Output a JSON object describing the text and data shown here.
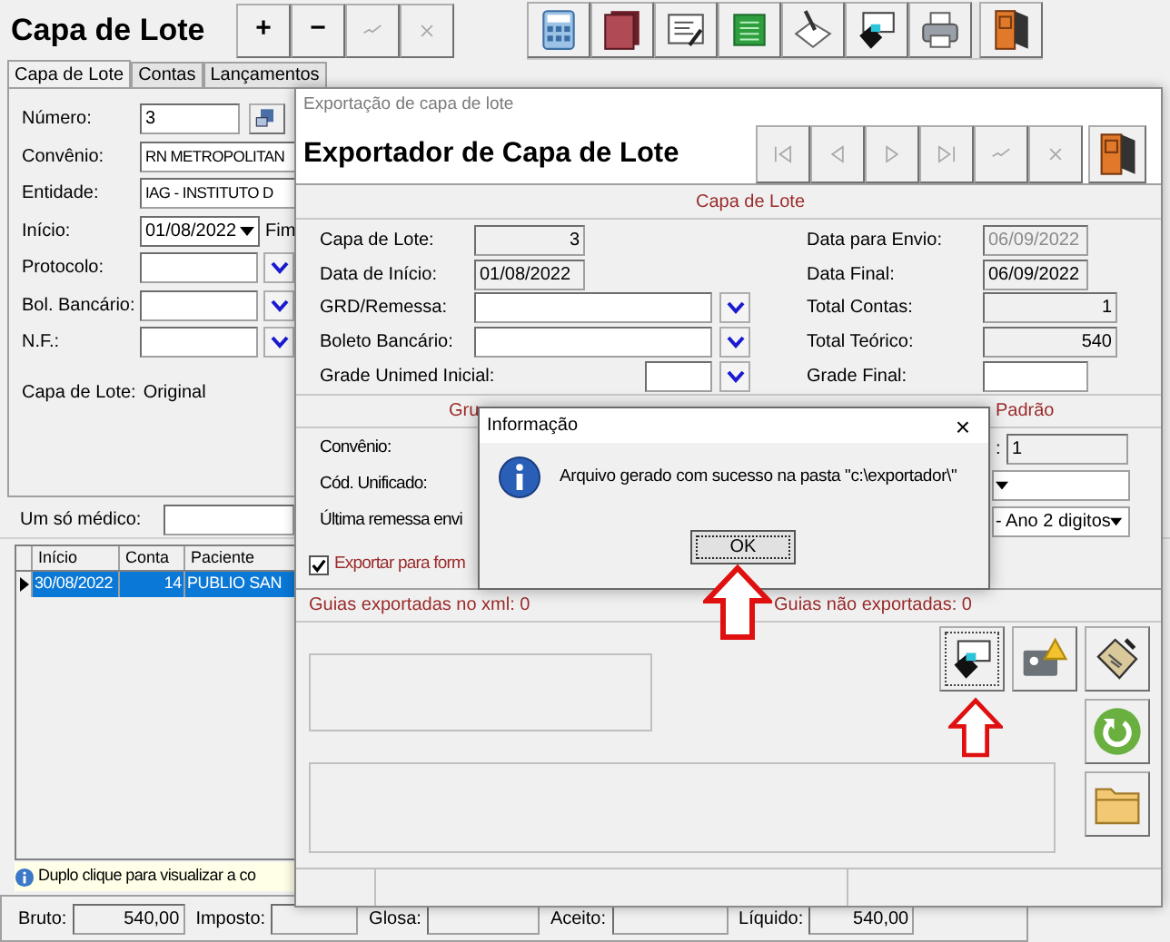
{
  "main_window": {
    "title": "Capa de Lote",
    "edit_buttons": [
      {
        "kind": "text",
        "label": "+",
        "disabled": false
      },
      {
        "kind": "text",
        "label": "−",
        "disabled": false
      },
      {
        "kind": "confirm",
        "disabled": true
      },
      {
        "kind": "cancel",
        "disabled": true
      }
    ],
    "tabs": [
      {
        "label": "Capa de Lote",
        "selected": true
      },
      {
        "label": "Contas",
        "selected": false
      },
      {
        "label": "Lançamentos",
        "selected": false
      }
    ],
    "fields": [
      {
        "kind": "text_with_button",
        "label": "Número:",
        "value": "3"
      },
      {
        "kind": "text",
        "label": "Convênio:",
        "value": "RN METROPOLITAN"
      },
      {
        "kind": "text",
        "label": "Entidade:",
        "value": "IAG - INSTITUTO D"
      },
      {
        "kind": "date",
        "label": "Início:",
        "value": "01/08/2022",
        "extra_label": "Fim"
      },
      {
        "kind": "lookup",
        "label": "Protocolo:"
      },
      {
        "kind": "lookup",
        "label": "Bol. Bancário:"
      },
      {
        "kind": "lookup",
        "label": "N.F.:"
      }
    ],
    "capa_status": {
      "label": "Capa de Lote:",
      "value": "Original"
    },
    "doctor_filter": {
      "label": "Um só médico:"
    },
    "grid": {
      "columns": [
        "Início",
        "Conta",
        "Paciente"
      ],
      "rows": [
        {
          "cells": [
            "30/08/2022",
            "14",
            "PUBLIO SAN"
          ],
          "selected": true
        }
      ]
    },
    "hint": "Duplo clique para visualizar a co",
    "totals": [
      {
        "label": "Bruto:",
        "value": "540,00"
      },
      {
        "label": "Imposto:"
      },
      {
        "label": "Glosa:"
      },
      {
        "label": "Aceito:"
      },
      {
        "label": "Líquido:",
        "value": "540,00"
      }
    ]
  },
  "exporter_window": {
    "window_title": "Exportação de capa de lote",
    "heading": "Exportador de Capa de Lote",
    "nav_buttons": [
      {
        "kind": "first",
        "disabled": true
      },
      {
        "kind": "previous",
        "disabled": true
      },
      {
        "kind": "next",
        "disabled": true
      },
      {
        "kind": "last",
        "disabled": true
      },
      {
        "kind": "confirm",
        "disabled": true
      },
      {
        "kind": "cancel",
        "disabled": true
      },
      {
        "kind": "exit",
        "disabled": false
      }
    ],
    "capa_section": {
      "title": "Capa de Lote",
      "left_fields": [
        {
          "kind": "readonly_number",
          "label": "Capa de Lote:",
          "value": "3"
        },
        {
          "kind": "readonly_text",
          "label": "Data de Início:",
          "value": "01/08/2022"
        },
        {
          "kind": "lookup",
          "label": "GRD/Remessa:"
        },
        {
          "kind": "lookup",
          "label": "Boleto Bancário:"
        },
        {
          "kind": "short_lookup",
          "label": "Grade Unimed Inicial:"
        }
      ],
      "right_fields": [
        {
          "kind": "readonly_dimmed",
          "label": "Data para Envio:",
          "value": "06/09/2022"
        },
        {
          "kind": "readonly_text",
          "label": "Data Final:",
          "value": "06/09/2022"
        },
        {
          "kind": "readonly_number",
          "label": "Total Contas:",
          "value": "1"
        },
        {
          "kind": "readonly_number",
          "label": "Total Teórico:",
          "value": "540"
        },
        {
          "kind": "input",
          "label": "Grade Final:"
        }
      ]
    },
    "group_section": {
      "left_title": "Gru",
      "right_title": "Padrão",
      "rows": [
        {
          "label": "Convênio:",
          "right": {
            "kind": "readonly",
            "label": ":",
            "value": "1"
          }
        },
        {
          "label": "Cód. Unificado:",
          "right": {
            "kind": "combo"
          }
        },
        {
          "label": "Última remessa envi",
          "right": {
            "kind": "combo",
            "value": "- Ano 2 digitos"
          }
        }
      ]
    },
    "export_option": {
      "label": "Exportar para form",
      "checked": true
    },
    "counts": [
      "Guias exportadas no xml: 0",
      "Guias não exportadas: 0"
    ]
  },
  "dialog": {
    "title": "Informação",
    "close": "×",
    "message": "Arquivo gerado com sucesso na pasta \"c:\\exportador\\\"",
    "ok": "OK"
  }
}
